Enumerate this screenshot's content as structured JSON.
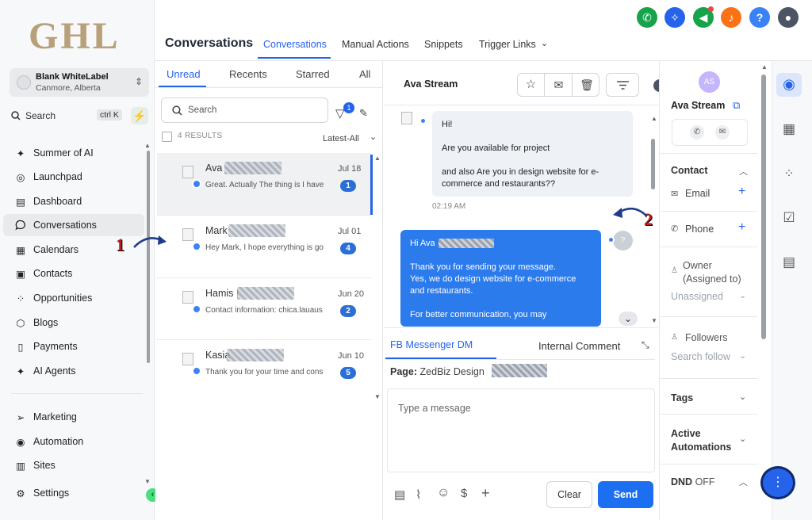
{
  "logo": "GHL",
  "account": {
    "name": "Blank WhiteLabel",
    "location": "Canmore, Alberta"
  },
  "sidebar_search": {
    "label": "Search",
    "shortcut": "ctrl K"
  },
  "nav": [
    {
      "label": "Summer of AI"
    },
    {
      "label": "Launchpad"
    },
    {
      "label": "Dashboard"
    },
    {
      "label": "Conversations"
    },
    {
      "label": "Calendars"
    },
    {
      "label": "Contacts"
    },
    {
      "label": "Opportunities"
    },
    {
      "label": "Blogs"
    },
    {
      "label": "Payments"
    },
    {
      "label": "AI Agents"
    },
    {
      "label": "Marketing"
    },
    {
      "label": "Automation"
    },
    {
      "label": "Sites"
    },
    {
      "label": "Settings"
    }
  ],
  "header": {
    "title": "Conversations",
    "tabs": [
      "Conversations",
      "Manual Actions",
      "Snippets",
      "Trigger Links"
    ]
  },
  "list": {
    "tabs": [
      "Unread",
      "Recents",
      "Starred",
      "All"
    ],
    "search_placeholder": "Search",
    "filter_count": "1",
    "results": "4 RESULTS",
    "sort": "Latest-All",
    "items": [
      {
        "name": "Ava",
        "preview": "Great. Actually The thing is I have",
        "date": "Jul 18",
        "count": "1"
      },
      {
        "name": "Mark",
        "preview": "Hey Mark, I hope everything is go",
        "date": "Jul 01",
        "count": "4"
      },
      {
        "name": "Hamis I",
        "preview": "Contact information: chica.lauaus",
        "date": "Jun 20",
        "count": "2"
      },
      {
        "name": "Kasia",
        "preview": "Thank you for your time and cons",
        "date": "Jun 10",
        "count": "5"
      }
    ]
  },
  "chat": {
    "name": "Ava Stream",
    "incoming": [
      "Hi!",
      "Are you available for project",
      "and also Are you in design website for e-commerce and restaurants??"
    ],
    "incoming_time": "02:19 AM",
    "outgoing": [
      "Hi Ava",
      "Thank you for sending your message.",
      "Yes, we do design website for e-commerce and restaurants.",
      "For better communication, you may"
    ],
    "channel_tab": "FB Messenger DM",
    "internal_tab": "Internal Comment",
    "page_label": "Page:",
    "page_value": "ZedBiz Design",
    "message_placeholder": "Type a message",
    "clear": "Clear",
    "send": "Send"
  },
  "contact": {
    "initials": "AS",
    "name": "Ava Stream",
    "section_contact": "Contact",
    "email": "Email",
    "phone": "Phone",
    "owner_label": "Owner (Assigned to)",
    "owner_value": "Unassigned",
    "followers_label": "Followers",
    "followers_placeholder": "Search follow",
    "tags": "Tags",
    "active_automations": "Active Automations",
    "dnd": "DND",
    "dnd_state": "OFF"
  },
  "annotations": [
    "1",
    "2"
  ]
}
